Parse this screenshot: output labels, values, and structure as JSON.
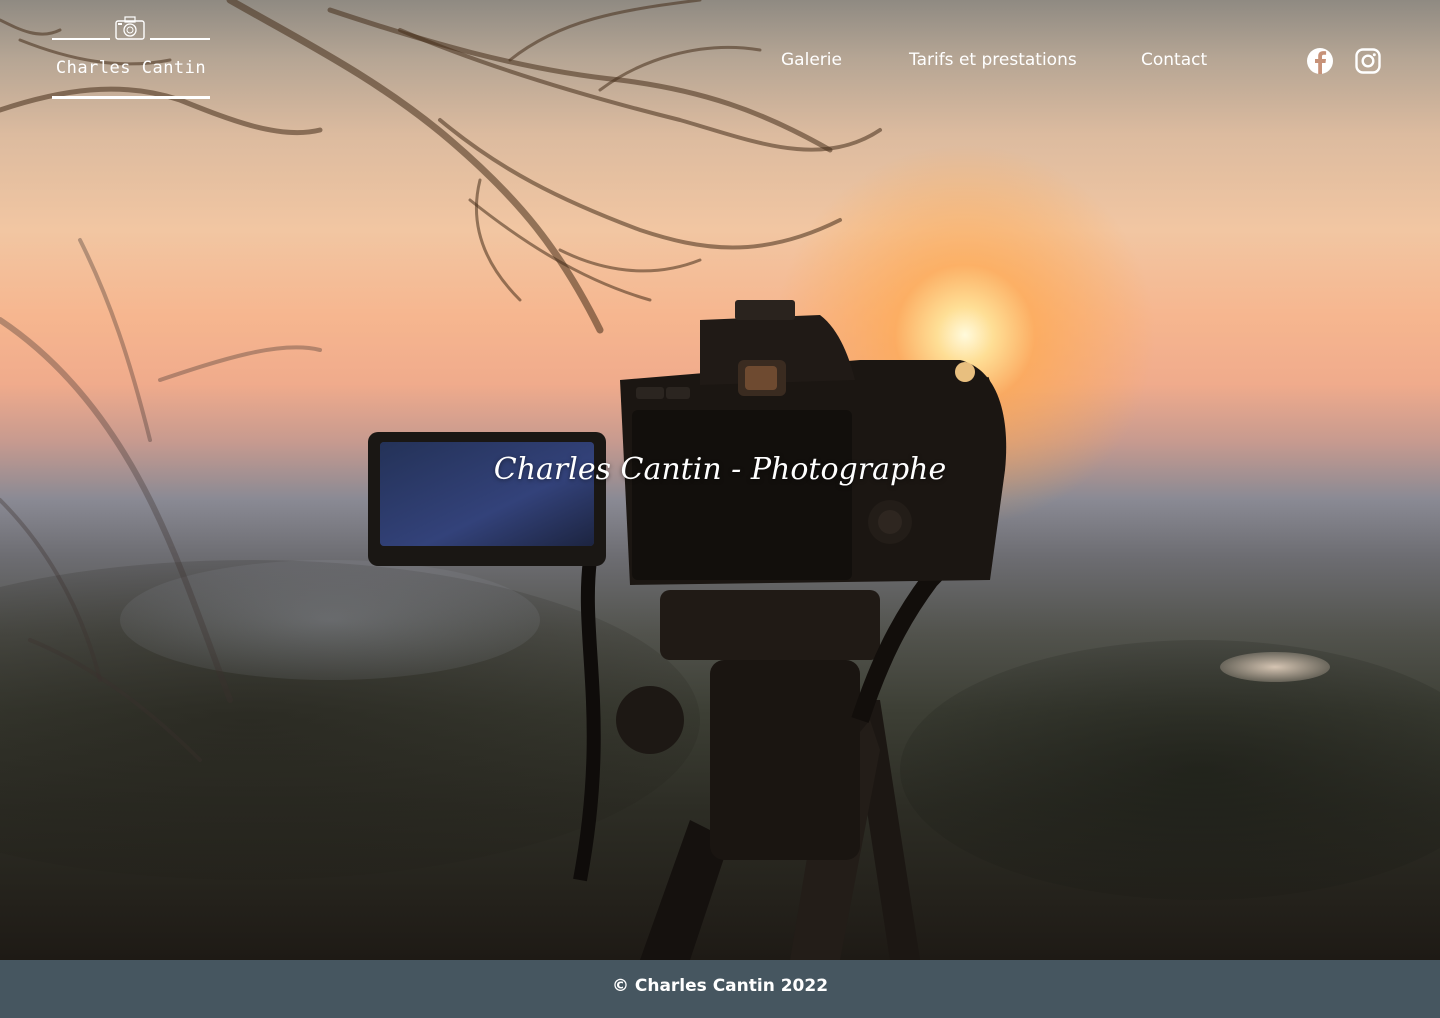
{
  "brand": {
    "name": "Charles Cantin",
    "logo_icon": "camera-icon"
  },
  "nav": {
    "items": [
      {
        "label": "Galerie"
      },
      {
        "label": "Tarifs et prestations"
      },
      {
        "label": "Contact"
      }
    ]
  },
  "social": {
    "facebook_icon": "facebook-icon",
    "instagram_icon": "instagram-icon"
  },
  "hero": {
    "title": "Charles Cantin - Photographe"
  },
  "footer": {
    "copyright": "© Charles Cantin 2022",
    "background_color": "#465660"
  }
}
